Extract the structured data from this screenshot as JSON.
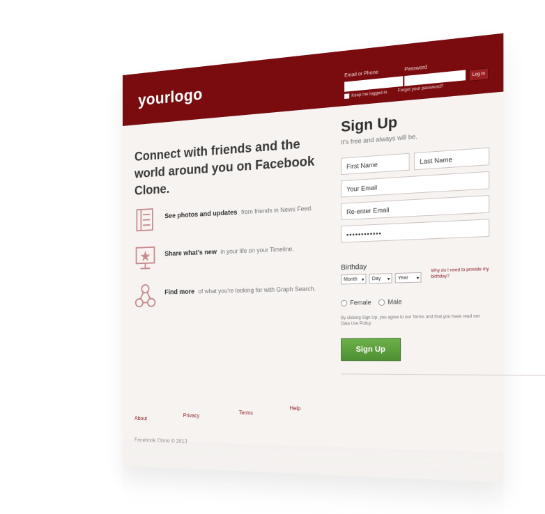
{
  "topbar": {
    "logo": "yourlogo",
    "email_label": "Email or Phone",
    "password_label": "Password",
    "login_button": "Log In",
    "keep_logged_in": "Keep me logged in",
    "forgot_password": "Forgot your password?"
  },
  "main": {
    "headline_line1": "Connect with friends and the",
    "headline_line2": "world around you on Facebook Clone.",
    "features": [
      {
        "title": "See photos and updates",
        "rest": "from friends in News Feed.",
        "icon": "news-feed-icon"
      },
      {
        "title": "Share what's new",
        "rest": "in your life on your Timeline.",
        "icon": "timeline-icon"
      },
      {
        "title": "Find more",
        "rest": "of what you're looking for with Graph Search.",
        "icon": "graph-search-icon"
      }
    ]
  },
  "signup": {
    "title": "Sign Up",
    "subtitle": "It's free and always will be.",
    "first_name": "First Name",
    "last_name": "Last Name",
    "email": "Your Email",
    "reenter_email": "Re-enter Email",
    "password_mask": "••••••••••••",
    "birthday_label": "Birthday",
    "month": "Month",
    "day": "Day",
    "year": "Year",
    "why_birthday": "Why do I need to provide my birthday?",
    "female": "Female",
    "male": "Male",
    "terms_text": "By clicking Sign Up, you agree to our Terms and that you have read our Data Use Policy.",
    "button": "Sign Up"
  },
  "footer": {
    "about": "About",
    "privacy": "Privacy",
    "terms": "Terms",
    "help": "Help",
    "copyright": "Facebook Clone © 2013"
  },
  "colors": {
    "brand": "#7a0c10",
    "accent_link": "#8a1b1f",
    "button_green": "#5a9b3c",
    "icon_red": "#c98a8d"
  }
}
